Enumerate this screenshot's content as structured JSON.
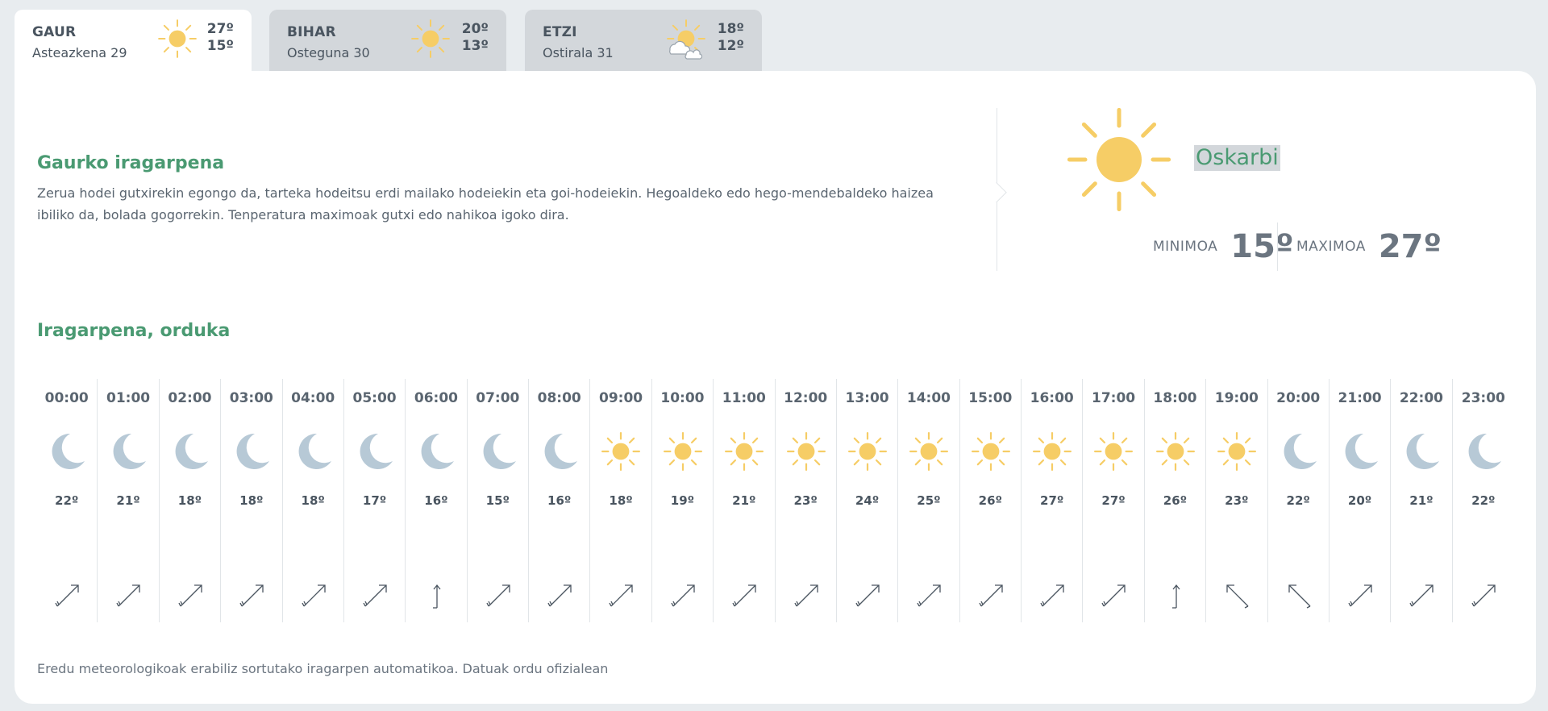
{
  "tabs": [
    {
      "day": "GAUR",
      "date": "Asteazkena 29",
      "max": "27º",
      "min": "15º",
      "icon": "sun-icon",
      "active": true
    },
    {
      "day": "BIHAR",
      "date": "Osteguna 30",
      "max": "20º",
      "min": "13º",
      "icon": "sun-icon",
      "active": false
    },
    {
      "day": "ETZI",
      "date": "Ostirala 31",
      "max": "18º",
      "min": "12º",
      "icon": "sun-cloud-icon",
      "active": false
    }
  ],
  "forecast": {
    "title": "Gaurko iragarpena",
    "text": "Zerua hodei gutxirekin egongo da, tarteka hodeitsu erdi mailako hodeiekin eta goi-hodeiekin. Hegoaldeko edo hego-mendebaldeko haizea ibiliko da, bolada gogorrekin. Tenperatura maximoak gutxi edo nahikoa igoko dira."
  },
  "summary": {
    "label": "Oskarbi",
    "min_label": "MINIMOA",
    "min_value": "15º",
    "max_label": "MAXIMOA",
    "max_value": "27º"
  },
  "hourly": {
    "title": "Iragarpena, orduka",
    "hours": [
      {
        "time": "00:00",
        "icon": "moon-icon",
        "temp": "22º",
        "wind": "sw"
      },
      {
        "time": "01:00",
        "icon": "moon-icon",
        "temp": "21º",
        "wind": "sw"
      },
      {
        "time": "02:00",
        "icon": "moon-icon",
        "temp": "18º",
        "wind": "sw"
      },
      {
        "time": "03:00",
        "icon": "moon-icon",
        "temp": "18º",
        "wind": "sw"
      },
      {
        "time": "04:00",
        "icon": "moon-icon",
        "temp": "18º",
        "wind": "sw"
      },
      {
        "time": "05:00",
        "icon": "moon-icon",
        "temp": "17º",
        "wind": "sw"
      },
      {
        "time": "06:00",
        "icon": "moon-icon",
        "temp": "16º",
        "wind": "s"
      },
      {
        "time": "07:00",
        "icon": "moon-icon",
        "temp": "15º",
        "wind": "sw"
      },
      {
        "time": "08:00",
        "icon": "moon-icon",
        "temp": "16º",
        "wind": "sw"
      },
      {
        "time": "09:00",
        "icon": "sun-icon",
        "temp": "18º",
        "wind": "sw"
      },
      {
        "time": "10:00",
        "icon": "sun-icon",
        "temp": "19º",
        "wind": "sw"
      },
      {
        "time": "11:00",
        "icon": "sun-icon",
        "temp": "21º",
        "wind": "sw"
      },
      {
        "time": "12:00",
        "icon": "sun-icon",
        "temp": "23º",
        "wind": "sw"
      },
      {
        "time": "13:00",
        "icon": "sun-icon",
        "temp": "24º",
        "wind": "sw"
      },
      {
        "time": "14:00",
        "icon": "sun-icon",
        "temp": "25º",
        "wind": "sw"
      },
      {
        "time": "15:00",
        "icon": "sun-icon",
        "temp": "26º",
        "wind": "sw"
      },
      {
        "time": "16:00",
        "icon": "sun-icon",
        "temp": "27º",
        "wind": "sw"
      },
      {
        "time": "17:00",
        "icon": "sun-icon",
        "temp": "27º",
        "wind": "sw"
      },
      {
        "time": "18:00",
        "icon": "sun-icon",
        "temp": "26º",
        "wind": "s"
      },
      {
        "time": "19:00",
        "icon": "sun-icon",
        "temp": "23º",
        "wind": "se"
      },
      {
        "time": "20:00",
        "icon": "moon-icon",
        "temp": "22º",
        "wind": "se"
      },
      {
        "time": "21:00",
        "icon": "moon-icon",
        "temp": "20º",
        "wind": "sw"
      },
      {
        "time": "22:00",
        "icon": "moon-icon",
        "temp": "21º",
        "wind": "sw"
      },
      {
        "time": "23:00",
        "icon": "moon-icon",
        "temp": "22º",
        "wind": "sw"
      }
    ]
  },
  "footnote": "Eredu meteorologikoak erabiliz sortutako iragarpen automatikoa. Datuak ordu ofizialean",
  "colors": {
    "green": "#4a9a72",
    "sun": "#f6cd66",
    "moon": "#b7c9d6",
    "text": "#4a5560"
  }
}
